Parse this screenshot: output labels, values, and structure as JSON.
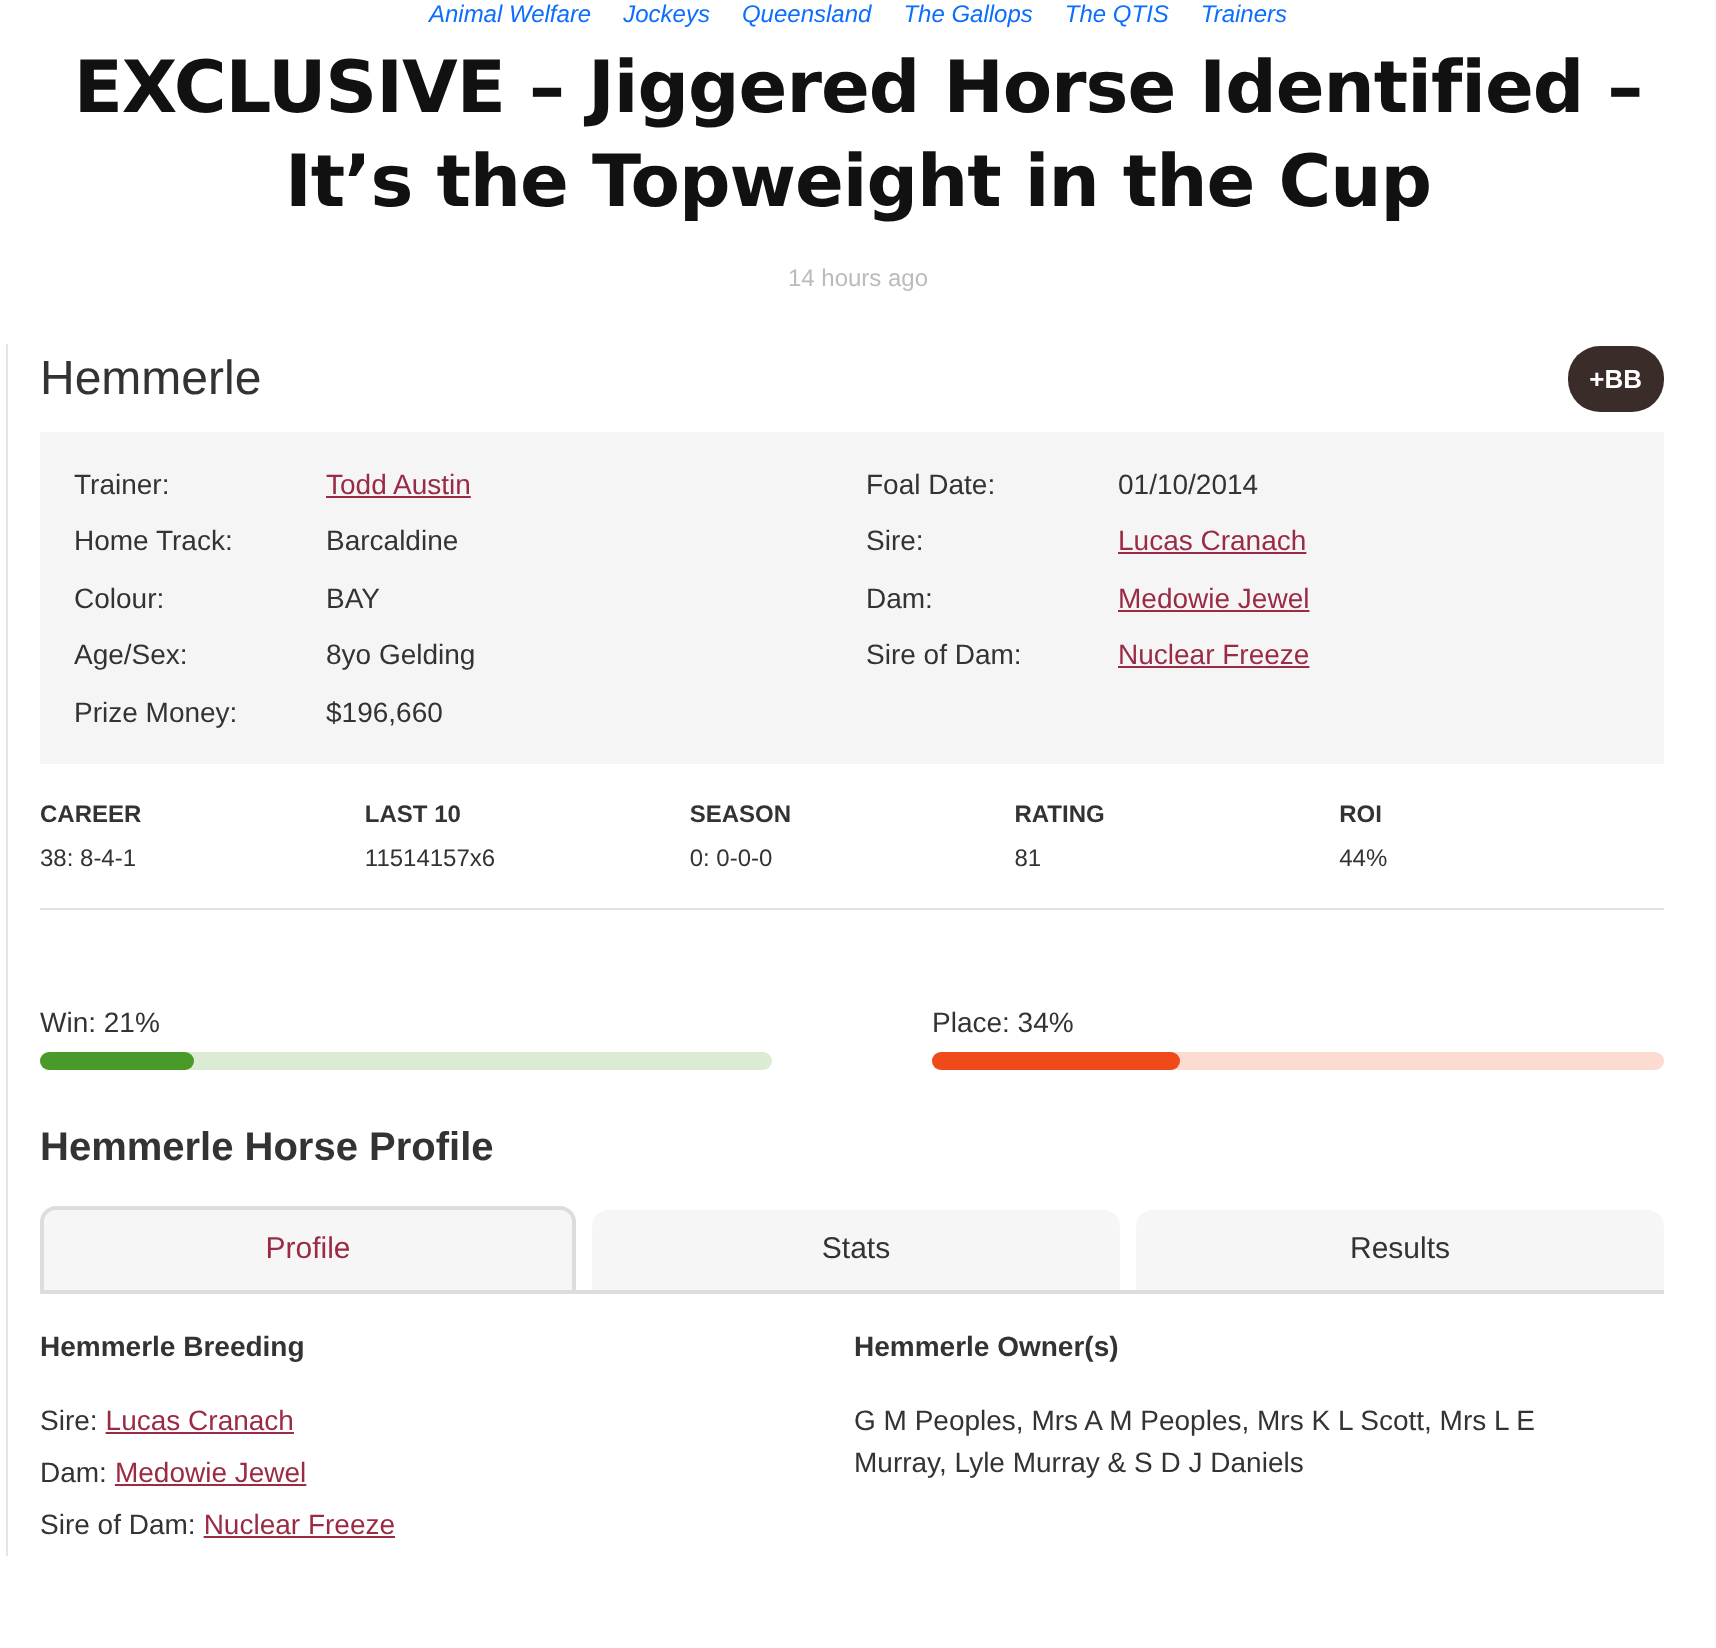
{
  "tags": [
    "Animal Welfare",
    "Jockeys",
    "Queensland",
    "The Gallops",
    "The QTIS",
    "Trainers"
  ],
  "headline": "EXCLUSIVE – Jiggered Horse Identified – It’s the Topweight in the Cup",
  "posted": "14 hours ago",
  "horse": {
    "name": "Hemmerle",
    "blackbook_button": "+BB"
  },
  "details_left": [
    {
      "label": "Trainer:",
      "value": "Todd Austin",
      "link": true
    },
    {
      "label": "Home Track:",
      "value": "Barcaldine",
      "link": false
    },
    {
      "label": "Colour:",
      "value": "BAY",
      "link": false
    },
    {
      "label": "Age/Sex:",
      "value": "8yo Gelding",
      "link": false
    },
    {
      "label": "Prize Money:",
      "value": "$196,660",
      "link": false
    }
  ],
  "details_right": [
    {
      "label": "Foal Date:",
      "value": "01/10/2014",
      "link": false
    },
    {
      "label": "Sire:",
      "value": "Lucas Cranach",
      "link": true
    },
    {
      "label": "Dam:",
      "value": "Medowie Jewel",
      "link": true
    },
    {
      "label": "Sire of Dam:",
      "value": "Nuclear Freeze",
      "link": true
    }
  ],
  "stats": [
    {
      "label": "CAREER",
      "value": "38: 8-4-1"
    },
    {
      "label": "LAST 10",
      "value": "11514157x6"
    },
    {
      "label": "SEASON",
      "value": "0: 0-0-0"
    },
    {
      "label": "RATING",
      "value": "81"
    },
    {
      "label": "ROI",
      "value": "44%"
    }
  ],
  "bars": [
    {
      "label": "Win: 21%",
      "level": 0.21,
      "color": "#4a9a2a"
    },
    {
      "label": "Place: 34%",
      "level": 0.34,
      "color": "#f04a1a"
    }
  ],
  "profile_title": "Hemmerle Horse Profile",
  "tabs": [
    {
      "label": "Profile",
      "selected": true
    },
    {
      "label": "Stats",
      "selected": false
    },
    {
      "label": "Results",
      "selected": false
    }
  ],
  "breeding": {
    "title": "Hemmerle Breeding",
    "rows": [
      {
        "label": "Sire:",
        "value": "Lucas Cranach"
      },
      {
        "label": "Dam:",
        "value": "Medowie Jewel"
      },
      {
        "label": "Sire of Dam:",
        "value": "Nuclear Freeze"
      }
    ]
  },
  "owners": {
    "title": "Hemmerle Owner(s)",
    "text": "G M Peoples, Mrs A M Peoples, Mrs K L Scott, Mrs L E Murray, Lyle Murray & S D J Daniels"
  }
}
